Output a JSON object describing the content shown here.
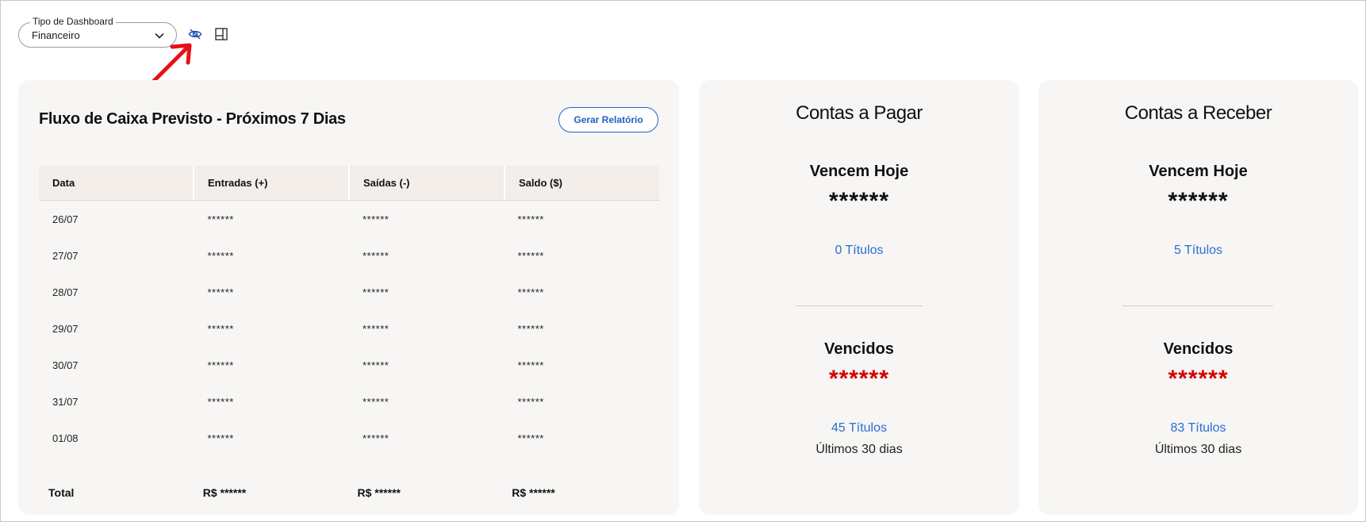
{
  "dashboard_select": {
    "label": "Tipo de Dashboard",
    "value": "Financeiro"
  },
  "toolbar": {
    "visibility_icon": "eye-slash-icon",
    "layout_icon": "layout-icon"
  },
  "cash_flow": {
    "title": "Fluxo de Caixa Previsto - Próximos 7 Dias",
    "report_button": "Gerar Relatório",
    "columns": [
      "Data",
      "Entradas (+)",
      "Saídas (-)",
      "Saldo ($)"
    ],
    "rows": [
      [
        "26/07",
        "******",
        "******",
        "******"
      ],
      [
        "27/07",
        "******",
        "******",
        "******"
      ],
      [
        "28/07",
        "******",
        "******",
        "******"
      ],
      [
        "29/07",
        "******",
        "******",
        "******"
      ],
      [
        "30/07",
        "******",
        "******",
        "******"
      ],
      [
        "31/07",
        "******",
        "******",
        "******"
      ],
      [
        "01/08",
        "******",
        "******",
        "******"
      ]
    ],
    "total": [
      "Total",
      "R$ ******",
      "R$ ******",
      "R$ ******"
    ]
  },
  "payables": {
    "title": "Contas a Pagar",
    "due_today_label": "Vencem Hoje",
    "due_today_value": "******",
    "due_today_link": "0 Títulos",
    "overdue_label": "Vencidos",
    "overdue_value": "******",
    "overdue_link": "45 Títulos",
    "overdue_period": "Últimos 30 dias"
  },
  "receivables": {
    "title": "Contas a Receber",
    "due_today_label": "Vencem Hoje",
    "due_today_value": "******",
    "due_today_link": "5 Títulos",
    "overdue_label": "Vencidos",
    "overdue_value": "******",
    "overdue_link": "83 Títulos",
    "overdue_period": "Últimos 30 dias"
  },
  "colors": {
    "accent": "#2a6dd4",
    "danger": "#d40000",
    "card_bg": "#f8f6f4",
    "annotation_arrow": "#e8101a"
  }
}
